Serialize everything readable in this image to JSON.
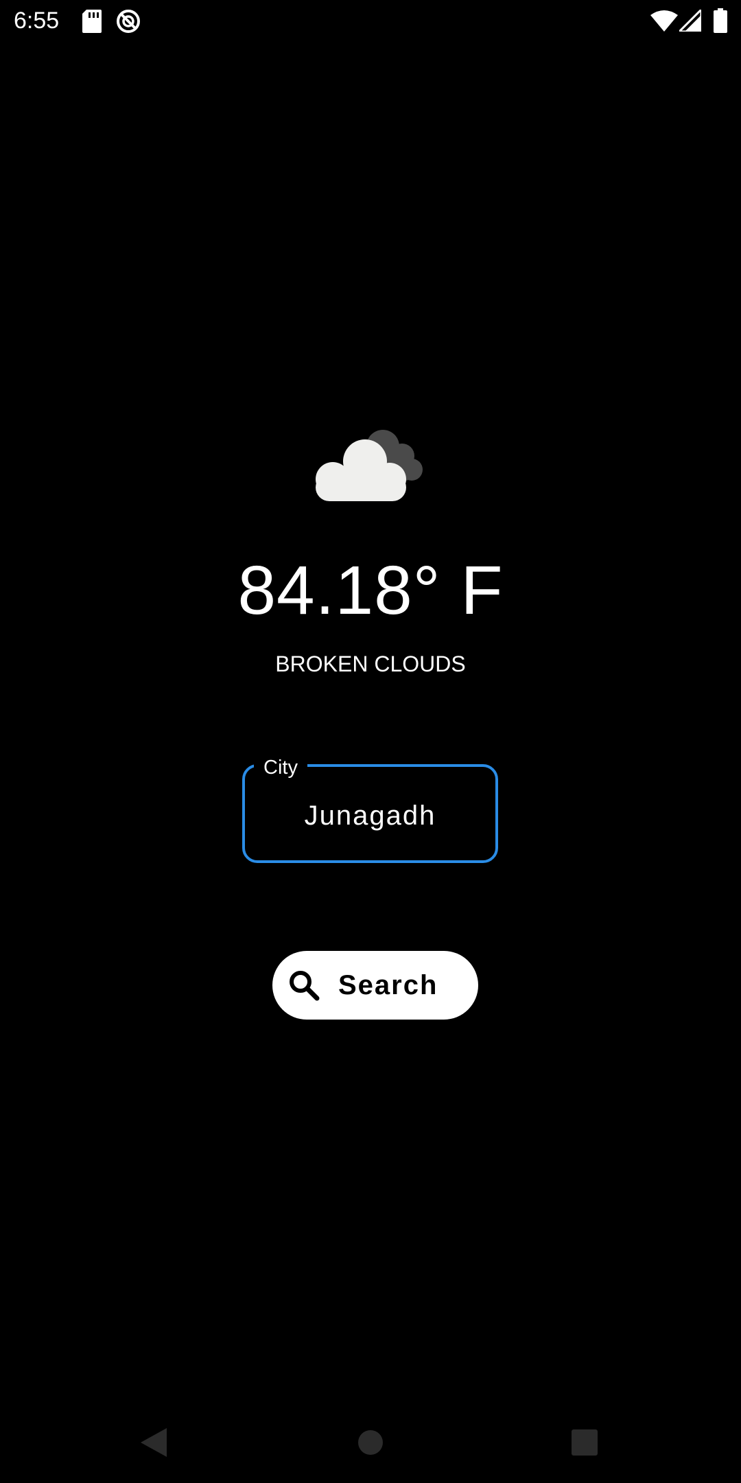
{
  "status_bar": {
    "time": "6:55",
    "icons": [
      "sd-card-icon",
      "sync-icon",
      "wifi-icon",
      "signal-icon",
      "battery-icon"
    ]
  },
  "weather": {
    "icon": "broken-clouds-icon",
    "temperature": "84.18° F",
    "condition": "BROKEN CLOUDS"
  },
  "city_field": {
    "label": "City",
    "value": "Junagadh"
  },
  "search_button": {
    "label": "Search",
    "icon": "search-icon"
  },
  "navigation_bar": {
    "buttons": [
      "back-icon",
      "home-icon",
      "recents-icon"
    ]
  },
  "colors": {
    "background": "#000000",
    "accent": "#2a8ce6",
    "text": "#ffffff",
    "button_background": "#ffffff"
  }
}
